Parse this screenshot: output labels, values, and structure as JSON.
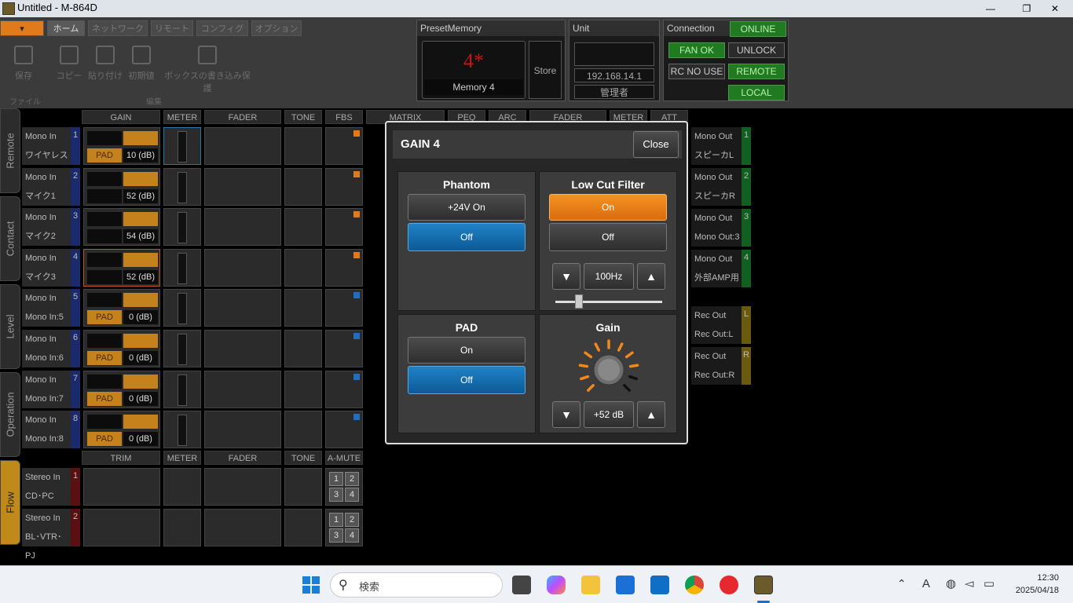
{
  "window": {
    "title": "Untitled - M-864D",
    "minimize": "—",
    "maximize": "❐",
    "close": "✕"
  },
  "ribbon": {
    "tabs": [
      "",
      "ホーム",
      "ネットワーク",
      "リモート",
      "コンフィグ",
      "オプション"
    ],
    "buttons": [
      "保存",
      "コピー",
      "貼り付け",
      "初期値",
      "ボックスの書き込み保護"
    ],
    "groups": [
      "ファイル",
      "編集"
    ]
  },
  "preset": {
    "header": "PresetMemory",
    "number": "4*",
    "name": "Memory 4",
    "store": "Store"
  },
  "unit": {
    "header": "Unit",
    "ip": "192.168.14.1",
    "role": "管理者"
  },
  "connection": {
    "header": "Connection",
    "status": "ONLINE",
    "fan": "FAN OK",
    "unlock": "UNLOCK",
    "rc": "RC NO USE",
    "remote": "REMOTE",
    "local": "LOCAL"
  },
  "side_tabs": [
    "Remote",
    "Contact",
    "Level",
    "Operation",
    "Flow"
  ],
  "mixer": {
    "col_headers": [
      "GAIN",
      "METER",
      "FADER",
      "TONE",
      "FBS",
      "MATRIX",
      "PEQ",
      "ARC",
      "FADER",
      "METER",
      "ATT"
    ],
    "col_headers2": [
      "TRIM",
      "METER",
      "FADER",
      "TONE",
      "A-MUTE"
    ],
    "inputs": [
      {
        "type": "Mono In",
        "num": "1",
        "name": "ワイヤレス",
        "pad": "PAD",
        "gain": "10 (dB)"
      },
      {
        "type": "Mono In",
        "num": "2",
        "name": "マイク1",
        "pad": "",
        "gain": "52 (dB)"
      },
      {
        "type": "Mono In",
        "num": "3",
        "name": "マイク2",
        "pad": "",
        "gain": "54 (dB)"
      },
      {
        "type": "Mono In",
        "num": "4",
        "name": "マイク3",
        "pad": "",
        "gain": "52 (dB)"
      },
      {
        "type": "Mono In",
        "num": "5",
        "name": "Mono In:5",
        "pad": "PAD",
        "gain": "0 (dB)"
      },
      {
        "type": "Mono In",
        "num": "6",
        "name": "Mono In:6",
        "pad": "PAD",
        "gain": "0 (dB)"
      },
      {
        "type": "Mono In",
        "num": "7",
        "name": "Mono In:7",
        "pad": "PAD",
        "gain": "0 (dB)"
      },
      {
        "type": "Mono In",
        "num": "8",
        "name": "Mono In:8",
        "pad": "PAD",
        "gain": "0 (dB)"
      }
    ],
    "stereo": [
      {
        "type": "Stereo In",
        "num": "1",
        "name": "CD･PC"
      },
      {
        "type": "Stereo In",
        "num": "2",
        "name": "BL･VTR･PJ"
      }
    ],
    "outputs": [
      {
        "type": "Mono Out",
        "num": "1",
        "name": "スピーカL"
      },
      {
        "type": "Mono Out",
        "num": "2",
        "name": "スピーカR"
      },
      {
        "type": "Mono Out",
        "num": "3",
        "name": "Mono Out:3"
      },
      {
        "type": "Mono Out",
        "num": "4",
        "name": "外部AMP用"
      },
      {
        "type": "Rec Out",
        "num": "L",
        "name": "Rec Out:L"
      },
      {
        "type": "Rec Out",
        "num": "R",
        "name": "Rec Out:R"
      }
    ],
    "amute": [
      "1",
      "2",
      "3",
      "4"
    ]
  },
  "modal": {
    "title": "GAIN 4",
    "close": "Close",
    "phantom": {
      "title": "Phantom",
      "on": "+24V On",
      "off": "Off",
      "selected": "off"
    },
    "lowcut": {
      "title": "Low Cut Filter",
      "on": "On",
      "off": "Off",
      "selected": "on",
      "freq": "100Hz",
      "down": "▼",
      "up": "▲",
      "slider_fraction": 0.22
    },
    "pad": {
      "title": "PAD",
      "on": "On",
      "off": "Off",
      "selected": "off"
    },
    "gain": {
      "title": "Gain",
      "value": "+52 dB",
      "down": "▼",
      "up": "▲",
      "knob_fraction": 0.87
    }
  },
  "taskbar": {
    "search_placeholder": "検索",
    "time": "12:30",
    "date": "2025/04/18",
    "ime": "A"
  },
  "colors": {
    "accent_orange": "#f0891c",
    "accent_blue": "#1373bb",
    "online_green": "#1f7a20"
  }
}
